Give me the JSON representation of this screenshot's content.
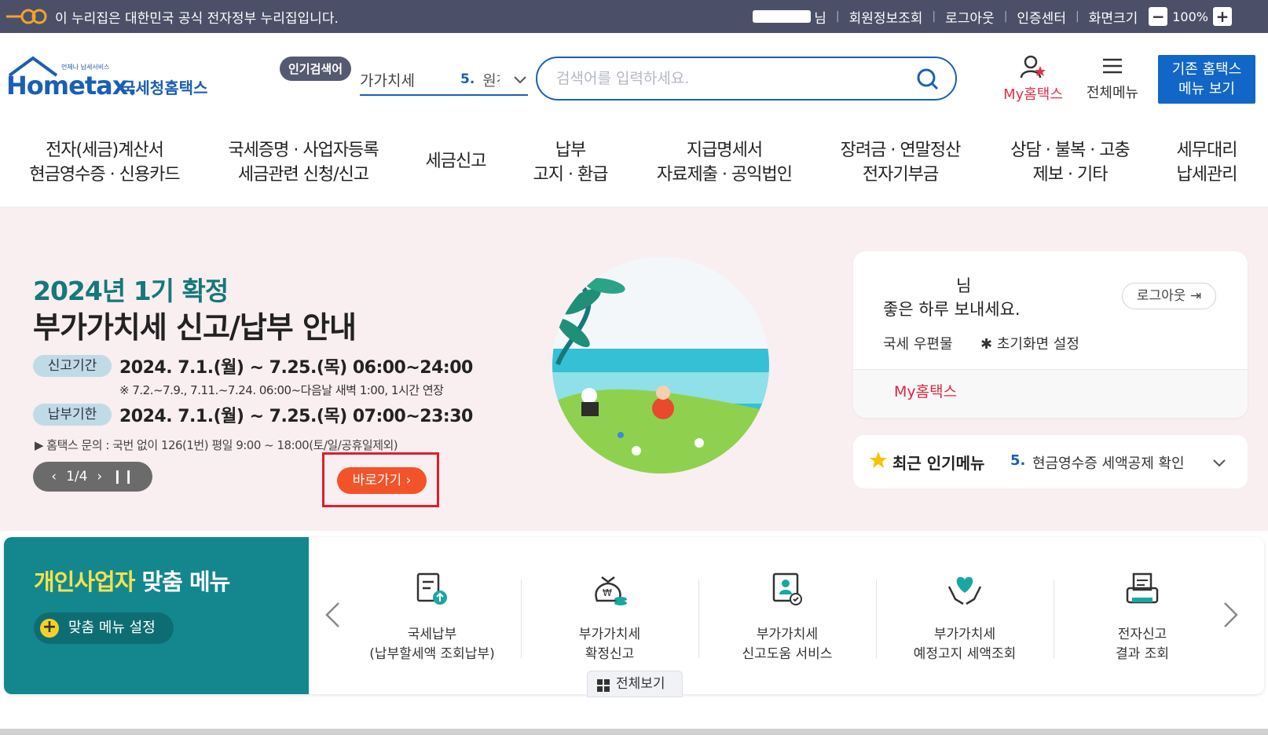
{
  "govbar": {
    "notice": "이 누리집은 대한민국 공식 전자정부 누리집입니다.",
    "user_suffix": "님",
    "member_info": "회원정보조회",
    "logout": "로그아웃",
    "cert_center": "인증센터",
    "screen_size": "화면크기",
    "zoom_minus": "−",
    "zoom_value": "100%",
    "zoom_plus": "+"
  },
  "header": {
    "logo_mini": "언제나 납세서비스",
    "logo_text": "Hometax.",
    "logo_kr": "국세청홈택스",
    "popular_label": "인기검색어",
    "popular_keyword": "가가치세",
    "popular_num": "5.",
    "popular_keyword2": "원천",
    "search_placeholder": "검색어를 입력하세요.",
    "my_hometax": "My홈택스",
    "all_menu": "전체메뉴",
    "old_menu_line1": "기존 홈택스",
    "old_menu_line2": "메뉴 보기"
  },
  "nav": [
    {
      "line1": "전자(세금)계산서",
      "line2": "현금영수증 · 신용카드"
    },
    {
      "line1": "국세증명 · 사업자등록",
      "line2": "세금관련 신청/신고"
    },
    {
      "line1": "세금신고",
      "line2": ""
    },
    {
      "line1": "납부",
      "line2": "고지 · 환급"
    },
    {
      "line1": "지급명세서",
      "line2": "자료제출 · 공익법인"
    },
    {
      "line1": "장려금 · 연말정산",
      "line2": "전자기부금"
    },
    {
      "line1": "상담 · 불복 · 고충",
      "line2": "제보 · 기타"
    },
    {
      "line1": "세무대리",
      "line2": "납세관리"
    }
  ],
  "hero": {
    "subtitle": "2024년 1기 확정",
    "title": "부가가치세 신고/납부 안내",
    "tag1": "신고기간",
    "period1": "2024. 7.1.(월) ~ 7.25.(목) 06:00~24:00",
    "note": "※ 7.2.~7.9., 7.11.~7.24. 06:00~다음날 새벽 1:00, 1시간 연장",
    "tag2": "납부기한",
    "period2": "2024. 7.1.(월) ~ 7.25.(목) 07:00~23:30",
    "inquiry": "▶ 홈택스 문의 : 국번 없이 126(1번) 평일 9:00 ~ 18:00(토/일/공휴일제외)",
    "pager": "1/4",
    "goto": "바로가기"
  },
  "login_card": {
    "name_suffix": "님",
    "greeting": "좋은 하루 보내세요.",
    "logout": "로그아웃",
    "mail": "국세 우편물",
    "init_setting": "초기화면 설정",
    "my_hometax": "My홈택스"
  },
  "recent": {
    "title": "최근 인기메뉴",
    "num": "5.",
    "text": "현금영수증 세액공제 확인"
  },
  "custom_menu": {
    "title_highlight": "개인사업자",
    "title_rest": " 맞춤 메뉴",
    "setting": "맞춤 메뉴 설정",
    "all_view": "전체보기",
    "services": [
      {
        "line1": "국세납부",
        "line2": "(납부할세액 조회납부)",
        "icon": "tax-payment-icon"
      },
      {
        "line1": "부가가치세",
        "line2": "확정신고",
        "icon": "money-bag-icon"
      },
      {
        "line1": "부가가치세",
        "line2": "신고도움 서비스",
        "icon": "help-document-icon"
      },
      {
        "line1": "부가가치세",
        "line2": "예정고지 세액조회",
        "icon": "heart-hands-icon"
      },
      {
        "line1": "전자신고",
        "line2": "결과 조회",
        "icon": "printer-result-icon"
      }
    ]
  },
  "colors": {
    "govbar": "#4b5068",
    "brand_blue": "#1a5fb4",
    "teal": "#13878d",
    "accent_orange": "#f25329",
    "highlight_red_box": "#e11d2a",
    "hero_bg": "#f9eef0"
  }
}
